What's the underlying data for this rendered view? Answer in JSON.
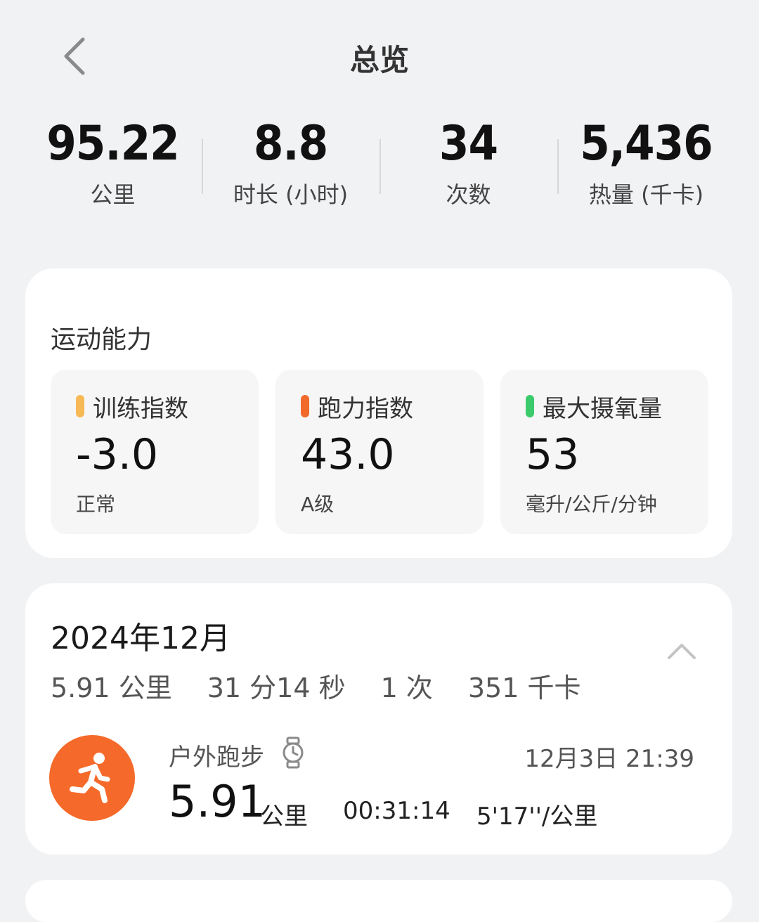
{
  "header": {
    "title": "总览"
  },
  "summary": [
    {
      "value": "95.22",
      "label": "公里"
    },
    {
      "value": "8.8",
      "label": "时长 (小时)"
    },
    {
      "value": "34",
      "label": "次数"
    },
    {
      "value": "5,436",
      "label": "热量 (千卡)"
    }
  ],
  "ability": {
    "title": "运动能力",
    "tiles": [
      {
        "label": "训练指数",
        "value": "-3.0",
        "sub": "正常",
        "color": "#f7b955"
      },
      {
        "label": "跑力指数",
        "value": "43.0",
        "sub": "A级",
        "color": "#f26a2b"
      },
      {
        "label": "最大摄氧量",
        "value": "53",
        "sub": "毫升/公斤/分钟",
        "color": "#3ccb6c"
      }
    ]
  },
  "month": {
    "title": "2024年12月",
    "stats": [
      "5.91 公里",
      "31 分14 秒",
      "1 次",
      "351 千卡"
    ],
    "record": {
      "type": "户外跑步",
      "datetime": "12月3日 21:39",
      "distance": "5.91",
      "unit": "公里",
      "duration": "00:31:14",
      "pace": "5'17''/公里"
    }
  },
  "icons": {
    "back": "chevron-left-icon",
    "collapse": "chevron-up-icon",
    "run": "running-person-icon",
    "watch": "watch-icon"
  },
  "colors": {
    "accent": "#f56a2a",
    "background": "#f1f2f4"
  }
}
